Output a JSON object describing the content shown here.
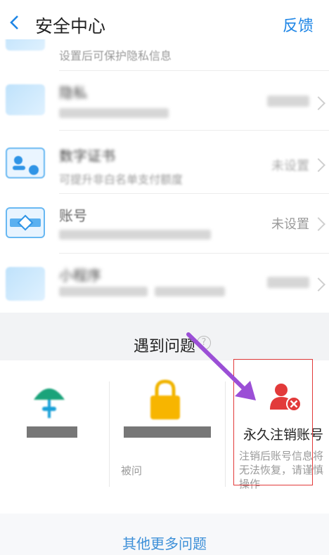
{
  "header": {
    "title": "安全中心",
    "feedback": "反馈"
  },
  "list": {
    "row0_sub": "设置后可保护隐私信息",
    "row1_title": "隐私",
    "row2_title": "数字证书",
    "row2_sub": "可提升非白名单支付额度",
    "row2_status": "未设置",
    "row3_title": "账号",
    "row3_status": "未设置",
    "row4_title": "小程序"
  },
  "problems": {
    "title": "遇到问题",
    "card3_title": "永久注销账号",
    "card3_desc": "注销后账号信息将无法恢复，请谨慎操作",
    "card2_desc_partial": "被问"
  },
  "more": "其他更多问题",
  "colors": {
    "accent": "#1f86e6",
    "danger": "#e23a3a",
    "arrow": "#9b4fd6"
  }
}
